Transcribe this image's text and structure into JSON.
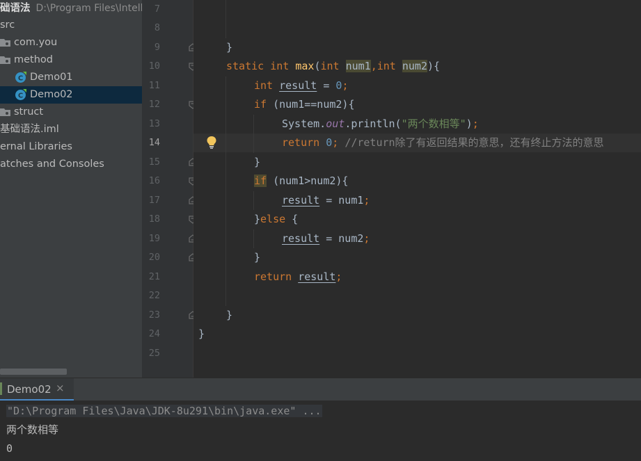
{
  "project_tree": {
    "root_name": "础语法",
    "root_path": "D:\\Program Files\\Intell",
    "items": [
      {
        "label": "src",
        "type": "source-folder"
      },
      {
        "label": "com.you",
        "type": "package"
      },
      {
        "label": "method",
        "type": "package"
      },
      {
        "label": "Demo01",
        "type": "class"
      },
      {
        "label": "Demo02",
        "type": "class",
        "selected": true
      },
      {
        "label": "struct",
        "type": "package"
      },
      {
        "label": "基础语法.iml",
        "type": "module-file"
      },
      {
        "label": "ernal Libraries",
        "type": "libraries"
      },
      {
        "label": "atches and Consoles",
        "type": "scratches"
      }
    ]
  },
  "editor": {
    "line_numbers": [
      "7",
      "8",
      "9",
      "10",
      "11",
      "12",
      "13",
      "14",
      "15",
      "16",
      "17",
      "18",
      "19",
      "20",
      "21",
      "22",
      "23",
      "24",
      "25"
    ],
    "current_line": "14",
    "code": {
      "l9_brace": "}",
      "l10_static": "static",
      "l10_int": "int",
      "l10_name": "max",
      "l10_open": "(",
      "l10_int2": "int",
      "l10_p1": "num1",
      "l10_comma": ",",
      "l10_int3": "int",
      "l10_p2": "num2",
      "l10_close": "){",
      "l11_int": "int",
      "l11_var": "result",
      "l11_eq": " = ",
      "l11_zero": "0",
      "l11_semi": ";",
      "l12_if": "if",
      "l12_cond": " (num1==num2){",
      "l13_sys": "System.",
      "l13_out": "out",
      "l13_println": ".println(",
      "l13_str": "\"两个数相等\"",
      "l13_close": ")",
      "l13_semi": ";",
      "l14_return": "return",
      "l14_zero": "0",
      "l14_semi": ";",
      "l14_comment": "//return除了有返回结果的意思，还有终止方法的意思",
      "l15_brace": "}",
      "l16_if": "if",
      "l16_cond": " (num1>num2){",
      "l17_var": "result",
      "l17_rest": " = num1",
      "l17_semi": ";",
      "l18_brace": "}",
      "l18_else": "else",
      "l18_open": " {",
      "l19_var": "result",
      "l19_rest": " = num2",
      "l19_semi": ";",
      "l20_brace": "}",
      "l21_return": "return",
      "l21_var": "result",
      "l21_semi": ";",
      "l23_brace": "}",
      "l24_brace": "}"
    }
  },
  "run_panel": {
    "tab_label": "Demo02",
    "close_glyph": "×",
    "output": [
      "\"D:\\Program Files\\Java\\JDK-8u291\\bin\\java.exe\" ...",
      "两个数相等",
      "0"
    ]
  },
  "colors": {
    "keyword": "#cc7832",
    "method": "#ffc66d",
    "number": "#6897bb",
    "string": "#6a8759",
    "comment": "#808080",
    "static_field": "#9876aa",
    "selection": "#0d293e",
    "tab_underline": "#4a88c7"
  }
}
